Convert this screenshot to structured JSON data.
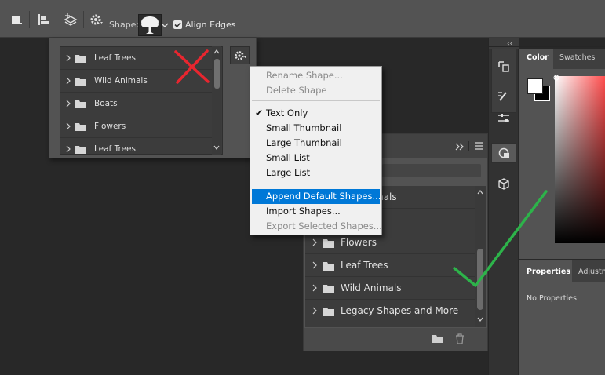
{
  "options_bar": {
    "shape_label": "Shape:",
    "align_edges_label": "Align Edges",
    "align_edges_checked": true
  },
  "shape_picker": {
    "items": [
      {
        "label": "Leaf Trees"
      },
      {
        "label": "Wild Animals"
      },
      {
        "label": "Boats"
      },
      {
        "label": "Flowers"
      },
      {
        "label": "Leaf Trees"
      }
    ]
  },
  "context_menu": {
    "items": [
      {
        "label": "Rename Shape...",
        "state": "disabled"
      },
      {
        "label": "Delete Shape",
        "state": "disabled"
      },
      {
        "label": "Text Only",
        "state": "checked"
      },
      {
        "label": "Small Thumbnail",
        "state": "normal"
      },
      {
        "label": "Large Thumbnail",
        "state": "normal"
      },
      {
        "label": "Small List",
        "state": "normal"
      },
      {
        "label": "Large List",
        "state": "normal"
      },
      {
        "label": "Append Default Shapes...",
        "state": "highlighted"
      },
      {
        "label": "Import Shapes...",
        "state": "normal"
      },
      {
        "label": "Export Selected Shapes...",
        "state": "disabled"
      }
    ]
  },
  "shapes_panel": {
    "items": [
      {
        "label": "mals"
      },
      {
        "label": ""
      },
      {
        "label": "Flowers"
      },
      {
        "label": "Leaf Trees"
      },
      {
        "label": "Wild Animals"
      },
      {
        "label": "Legacy Shapes and More"
      }
    ]
  },
  "color_panel": {
    "tab_color": "Color",
    "tab_swatches": "Swatches",
    "foreground": "#ffffff",
    "background": "#000000"
  },
  "properties_panel": {
    "tab_properties": "Properties",
    "tab_adjustments": "Adjustm",
    "empty_text": "No Properties"
  },
  "annotations": {
    "cross_color": "#e8262f",
    "check_color": "#2db34a"
  }
}
